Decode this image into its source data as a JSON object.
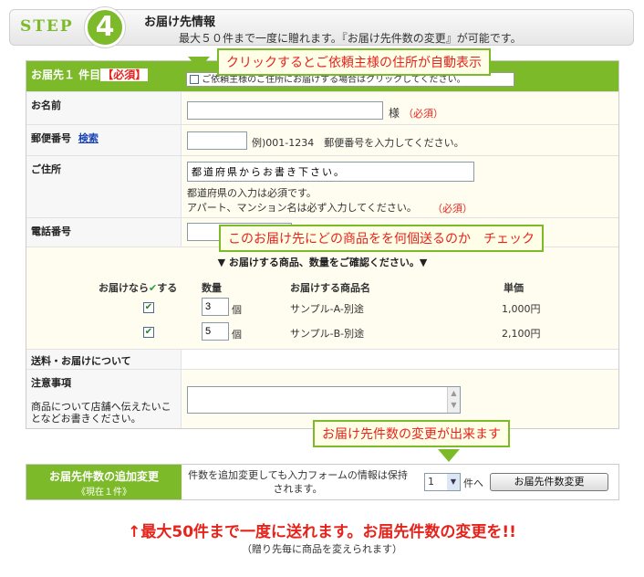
{
  "step": {
    "word": "STEP",
    "number": "4",
    "title": "お届け先情報",
    "subtitle": "最大５０件まで一度に贈れます。『お届け先件数の変更』が可能です。"
  },
  "header": {
    "label_main": "お届先１ 件目",
    "label_required": "【必須】",
    "checkbox_text": "ご依頼主様のご住所にお届けする場合はクリックしてください。"
  },
  "callouts": {
    "auto_fill": "クリックするとご依頼主様の住所が自動表示",
    "which_product": "このお届け先にどの商品をを何個送るのか　チェック",
    "change_count": "お届け先件数の変更が出来ます"
  },
  "fields": {
    "name_label": "お名前",
    "name_suffix": "様",
    "name_required": "（必須）",
    "zip_label": "郵便番号",
    "zip_search": "検索",
    "zip_hint": "例)001-1234　郵便番号を入力してください。",
    "address_label": "ご住所",
    "address_placeholder": "都道府県からお書き下さい。",
    "address_note1": "都道府県の入力は必須です。",
    "address_note2": "アパート、マンション名は必ず入力してください。",
    "address_required": "（必須）",
    "phone_label": "電話番号"
  },
  "products": {
    "heading": "▼ お届けする商品、数量をご確認ください。▼",
    "col_deliver": "お届けなら",
    "col_deliver_check": "✔",
    "col_deliver_suffix": "する",
    "col_qty": "数量",
    "col_name": "お届けする商品名",
    "col_price": "単価",
    "rows": [
      {
        "checked": "✔",
        "qty": "3",
        "unit": "個",
        "name": "サンプル-A-別途",
        "price": "1,000円"
      },
      {
        "checked": "✔",
        "qty": "5",
        "unit": "個",
        "name": "サンプル-B-別途",
        "price": "2,100円"
      }
    ]
  },
  "shipping": {
    "label": "送料・お届けについて"
  },
  "notes": {
    "label": "注意事項",
    "description": "商品について店舗へ伝えたいことなどお書きください。"
  },
  "bottom": {
    "label": "お届先件数の追加変更",
    "current": "《現在１件》",
    "info": "件数を追加変更しても入力フォームの情報は保持されます。",
    "select_value": "1",
    "select_suffix": "件へ",
    "button": "お届先件数変更"
  },
  "footer": {
    "headline": "↑最大50件まで一度に送れます。お届先件数の変更を!!",
    "note": "（贈り先毎に商品を変えられます）"
  },
  "colors": {
    "accent": "#7cba2a",
    "alert": "#e6231b"
  }
}
